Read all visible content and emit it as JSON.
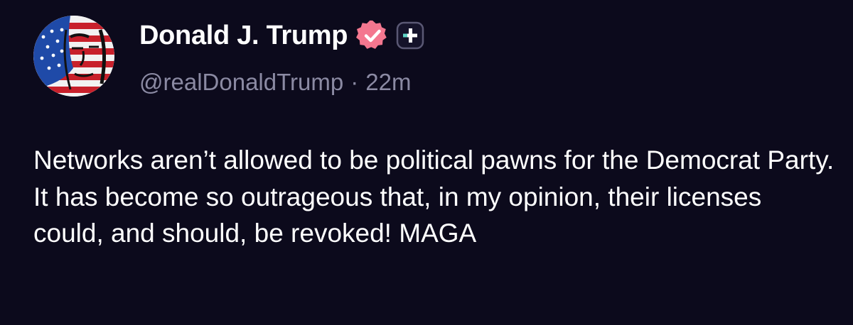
{
  "post": {
    "author": {
      "display_name": "Donald J. Trump",
      "handle": "@realDonaldTrump",
      "verified_badge_icon": "verified-badge-icon",
      "verified_badge_color": "#f4778f",
      "plus_icon": "plus-badge-icon"
    },
    "separator": "·",
    "timestamp": "22m",
    "text": "Networks aren’t allowed to be political pawns for the Democrat Party. It has become so outrageous that, in my opinion, their licenses could, and should, be revoked! MAGA"
  },
  "colors": {
    "background": "#0c0a1c",
    "name_text": "#ffffff",
    "meta_text": "#8b8aa3",
    "body_text": "#ffffff"
  }
}
